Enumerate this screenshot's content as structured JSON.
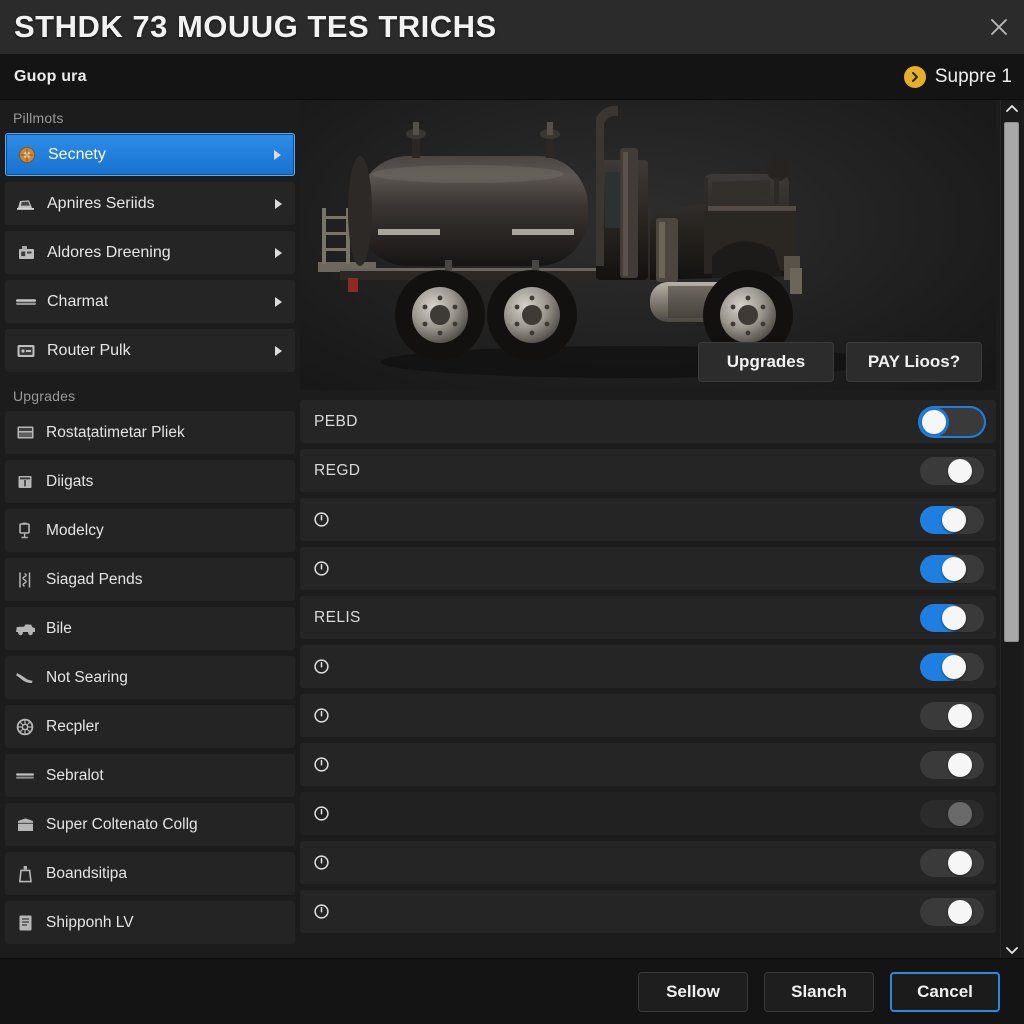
{
  "window": {
    "title": "STHDK 73 MOUUG TES TRICHS",
    "close_icon": "close-icon"
  },
  "subheader": {
    "title": "Guop ura",
    "badge_icon": "chevron-right-circle-icon",
    "right_label": "Suppre 1"
  },
  "sidebar": {
    "nav_heading": "Pillmots",
    "nav_items": [
      {
        "label": "Secnety",
        "icon": "emblem-icon",
        "selected": true,
        "arrow": "chevron-right-icon"
      },
      {
        "label": "Apnires Seriids",
        "icon": "truck-cab-icon",
        "selected": false,
        "arrow": "chevron-right-icon"
      },
      {
        "label": "Aldores Dreening",
        "icon": "engine-block-icon",
        "selected": false,
        "arrow": "chevron-right-icon"
      },
      {
        "label": "Charmat",
        "icon": "bumper-icon",
        "selected": false,
        "arrow": "chevron-right-icon"
      },
      {
        "label": "Router Pulk",
        "icon": "panel-icon",
        "selected": false,
        "arrow": "chevron-right-icon"
      }
    ],
    "upgrades_heading": "Upgrades",
    "upgrade_items": [
      {
        "label": "Rostațatimetar Pliek",
        "icon": "window-panel-icon"
      },
      {
        "label": "Diigats",
        "icon": "grille-icon"
      },
      {
        "label": "Modelcy",
        "icon": "mirror-icon"
      },
      {
        "label": "Siagad Pends",
        "icon": "suspension-icon"
      },
      {
        "label": "Bile",
        "icon": "truck-icon"
      },
      {
        "label": "Not Searing",
        "icon": "seat-icon"
      },
      {
        "label": "Recpler",
        "icon": "wheel-icon"
      },
      {
        "label": "Sebralot",
        "icon": "bar-icon"
      },
      {
        "label": "Super Coltenato Collg",
        "icon": "box-icon"
      },
      {
        "label": "Boandsitipa",
        "icon": "tank-icon"
      },
      {
        "label": "Shipponh LV",
        "icon": "document-icon"
      }
    ]
  },
  "preview": {
    "vehicle_name": "tanker-truck-render",
    "buttons": [
      {
        "label": "Upgrades"
      },
      {
        "label": "PAY Lioos?"
      }
    ]
  },
  "settings": {
    "rows": [
      {
        "label": "PEBD",
        "icon": null,
        "toggle": "off-left-focused"
      },
      {
        "label": "REGD",
        "icon": null,
        "toggle": "off"
      },
      {
        "label": null,
        "icon": "clock-icon",
        "toggle": "on"
      },
      {
        "label": null,
        "icon": "clock-icon",
        "toggle": "on"
      },
      {
        "label": "RELIS",
        "icon": null,
        "toggle": "on"
      },
      {
        "label": null,
        "icon": "clock-icon",
        "toggle": "on"
      },
      {
        "label": null,
        "icon": "clock-icon",
        "toggle": "off"
      },
      {
        "label": null,
        "icon": "clock-icon",
        "toggle": "off"
      },
      {
        "label": null,
        "icon": "clock-icon",
        "toggle": "off-faded"
      },
      {
        "label": null,
        "icon": "clock-icon",
        "toggle": "off"
      },
      {
        "label": null,
        "icon": "clock-icon",
        "toggle": "off"
      }
    ]
  },
  "scrollbar": {
    "up_icon": "chevron-up-icon",
    "down_icon": "chevron-down-icon",
    "thumb_position_percent": 0
  },
  "footer": {
    "buttons": [
      {
        "label": "Sellow",
        "primary": false
      },
      {
        "label": "Slanch",
        "primary": false
      },
      {
        "label": "Cancel",
        "primary": true
      }
    ]
  },
  "colors": {
    "accent_blue": "#1e7fe0",
    "selected_nav": "#2f8ce8",
    "badge_gold": "#e5b028",
    "window_bg": "#1c1c1c",
    "titlebar_bg": "#2b2b2b",
    "subheader_bg": "#141414",
    "row_bg": "#252525",
    "scrollbar_thumb": "#a8a8a8"
  }
}
